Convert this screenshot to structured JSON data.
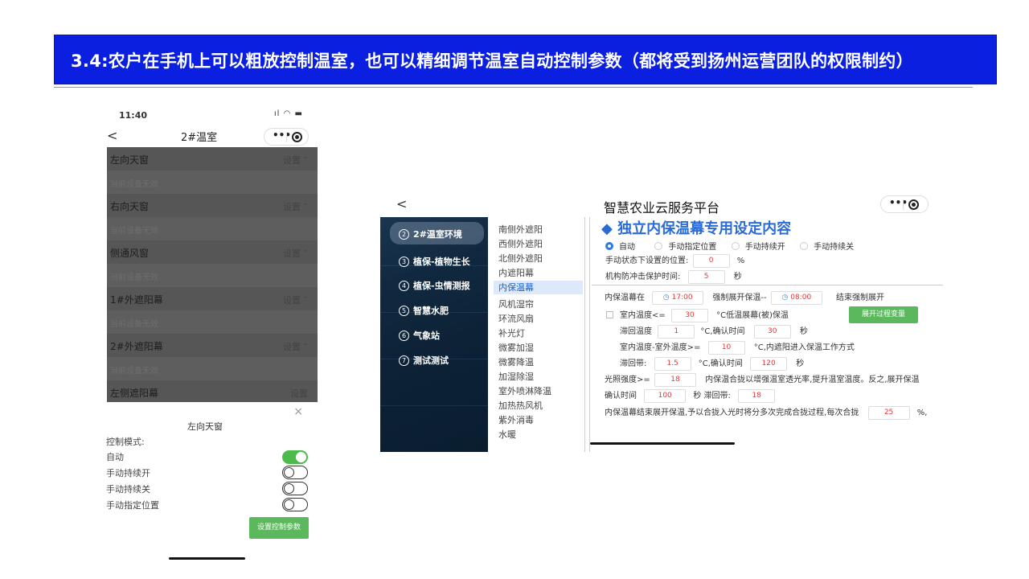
{
  "banner": {
    "text": "3.4:农户在手机上可以粗放控制温室，也可以精细调节温室自动控制参数（都将受到扬州运营团队的权限制约）"
  },
  "phone1": {
    "time": "11:40",
    "status_icons": "...ıl ᯤ ▬",
    "back": "<",
    "title": "2#温室",
    "capsule_dots": "•••",
    "devices": [
      {
        "name": "左向天窗",
        "setting": "设置 ˅",
        "note": "当前设备无效"
      },
      {
        "name": "右向天窗",
        "setting": "设置 ˅",
        "note": "当前设备无效"
      },
      {
        "name": "侧通风窗",
        "setting": "设置 ˅",
        "note": "当前设备无效"
      },
      {
        "name": "1#外遮阳幕",
        "setting": "设置 ˅",
        "note": "当前设备无效"
      },
      {
        "name": "2#外遮阳幕",
        "setting": "设置 ˅",
        "note": "当前设备无效"
      },
      {
        "name": "左侧遮阳幕",
        "setting": "设置",
        "note": ""
      }
    ],
    "sheet": {
      "close": "×",
      "title": "左向天窗",
      "mode_label": "控制模式:",
      "modes": [
        {
          "label": "自动",
          "on": true
        },
        {
          "label": "手动持续开",
          "on": false
        },
        {
          "label": "手动持续关",
          "on": false
        },
        {
          "label": "手动指定位置",
          "on": false
        }
      ],
      "button": "设置控制参数"
    }
  },
  "phone2": {
    "back": "<",
    "title": "智慧农业云服务平台",
    "capsule_dots": "•••",
    "left_menu": [
      {
        "num": "2",
        "label": "2#温室环境",
        "active": true
      },
      {
        "num": "3",
        "label": "植保-植物生长",
        "active": false
      },
      {
        "num": "4",
        "label": "植保-虫情测报",
        "active": false
      },
      {
        "num": "5",
        "label": "智慧水肥",
        "active": false
      },
      {
        "num": "6",
        "label": "气象站",
        "active": false
      },
      {
        "num": "7",
        "label": "测试测试",
        "active": false
      }
    ],
    "mid_menu": [
      {
        "label": "南侧外遮阳",
        "active": false
      },
      {
        "label": "西侧外遮阳",
        "active": false
      },
      {
        "label": "北侧外遮阳",
        "active": false
      },
      {
        "label": "内遮阳幕",
        "active": false
      },
      {
        "label": "内保温幕",
        "active": true
      },
      {
        "label": "风机湿帘",
        "active": false
      },
      {
        "label": "环流风扇",
        "active": false
      },
      {
        "label": "补光灯",
        "active": false
      },
      {
        "label": "微雾加湿",
        "active": false
      },
      {
        "label": "微雾降温",
        "active": false
      },
      {
        "label": "加湿除湿",
        "active": false
      },
      {
        "label": "室外喷淋降温",
        "active": false
      },
      {
        "label": "加热热风机",
        "active": false
      },
      {
        "label": "紫外消毒",
        "active": false
      },
      {
        "label": "水暖",
        "active": false
      }
    ],
    "content": {
      "title": "◆ 独立内保温幕专用设定内容",
      "modes": [
        {
          "label": "自动",
          "on": true
        },
        {
          "label": "手动指定位置",
          "on": false
        },
        {
          "label": "手动持续开",
          "on": false
        },
        {
          "label": "手动持续关",
          "on": false
        }
      ],
      "manual_pos_label": "手动状态下设置的位置:",
      "manual_pos_value": "0",
      "manual_pos_unit": "%",
      "protect_label": "机构防冲击保护时间:",
      "protect_value": "5",
      "protect_unit": "秒",
      "close_at_label": "内保温幕在",
      "close_at_time": "17:00",
      "force_open_label": "强制展开保温--",
      "force_open_time": "08:00",
      "force_end_label": "结束强制展开",
      "indoor_temp_label": "室内温度<=",
      "indoor_temp_value": "30",
      "indoor_temp_suffix": "°C低温展幕(被)保温",
      "process_button": "展开过程变量",
      "hyst_label": "滞回温度",
      "hyst_value": "1",
      "hyst_confirm_label": "°C,确认时间",
      "hyst_confirm_value": "30",
      "sec": "秒",
      "diff_label": "室内温度-室外温度>=",
      "diff_value": "10",
      "diff_suffix": "°C,内遮阳进入保温工作方式",
      "band_label": "滞回带:",
      "band_value": "1.5",
      "band_confirm_label": "°C,确认时间",
      "band_confirm_value": "120",
      "light_label": "光照强度>=",
      "light_value": "18",
      "light_suffix": "内保温合拢以增强温室透光率,提升温室温度。反之,展开保温",
      "confirm_label": "确认时间",
      "confirm_value": "100",
      "confirm_suffix": "秒 滞回带:",
      "confirm_band_value": "18",
      "end_label": "内保温幕结束展开保温,予以合拢入光时将分多次完成合拢过程,每次合拢",
      "end_value": "25",
      "end_suffix": "%,"
    }
  },
  "colors": {
    "banner": "#0a1fe0",
    "accent_blue": "#2a6bd4",
    "green": "#5cb85c",
    "red_value": "#e33"
  }
}
